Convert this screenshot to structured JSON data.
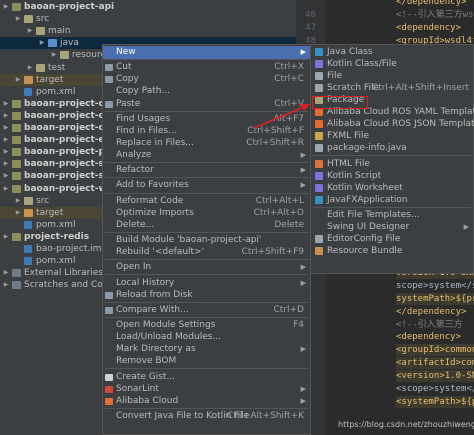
{
  "colors": {
    "menu_active": "#4b6eaf",
    "tree_bg": "#3c3f41",
    "editor_bg": "#2b2b2b",
    "red_annotation": "#e02020"
  },
  "tree": {
    "rows": [
      {
        "label": "baoan-project-api",
        "indent": 0,
        "icon": "folder-mod",
        "bold": true
      },
      {
        "label": "src",
        "indent": 1,
        "icon": "folder"
      },
      {
        "label": "main",
        "indent": 2,
        "icon": "folder"
      },
      {
        "label": "java",
        "indent": 3,
        "icon": "folder-blue",
        "selected": true
      },
      {
        "label": "resources",
        "indent": 4,
        "icon": "folder"
      },
      {
        "label": "test",
        "indent": 2,
        "icon": "folder"
      },
      {
        "label": "target",
        "indent": 1,
        "icon": "folder-orange",
        "highlight": true
      },
      {
        "label": "pom.xml",
        "indent": 1,
        "icon": "file-m"
      },
      {
        "label": "baoan-project-chec",
        "indent": 0,
        "icon": "folder-mod",
        "bold": true
      },
      {
        "label": "baoan-project-comr",
        "indent": 0,
        "icon": "folder-mod",
        "bold": true
      },
      {
        "label": "baoan-project-dao",
        "indent": 0,
        "icon": "folder-mod",
        "bold": true
      },
      {
        "label": "baoan-project-elast",
        "indent": 0,
        "icon": "folder-mod",
        "bold": true
      },
      {
        "label": "baoan-project-pack",
        "indent": 0,
        "icon": "folder-mod",
        "bold": true
      },
      {
        "label": "baoan-project-secu",
        "indent": 0,
        "icon": "folder-mod",
        "bold": true
      },
      {
        "label": "baoan-project-sms",
        "indent": 0,
        "icon": "folder-mod",
        "bold": true
      },
      {
        "label": "baoan-project-web",
        "indent": 0,
        "icon": "folder-mod",
        "bold": true
      },
      {
        "label": "src",
        "indent": 1,
        "icon": "folder"
      },
      {
        "label": "target",
        "indent": 1,
        "icon": "folder-orange",
        "highlight": true
      },
      {
        "label": "pom.xml",
        "indent": 1,
        "icon": "file-m"
      },
      {
        "label": "project-redis",
        "indent": 0,
        "icon": "folder-mod",
        "bold": true
      },
      {
        "label": "bao-project.iml",
        "indent": 1,
        "icon": "file-m"
      },
      {
        "label": "pom.xml",
        "indent": 1,
        "icon": "file-m"
      },
      {
        "label": "External Libraries",
        "indent": 0,
        "icon": "libs"
      },
      {
        "label": "Scratches and Consoles",
        "indent": 0,
        "icon": "libs"
      }
    ]
  },
  "editor": {
    "lines": [
      {
        "num": "",
        "text": "</dependency>",
        "kind": "tag"
      },
      {
        "num": "46",
        "text": "<!--引入第三方wsdl4j",
        "kind": "cmt"
      },
      {
        "num": "47",
        "text": "<dependency>",
        "kind": "tag"
      },
      {
        "num": "48",
        "text": "<groupId>wsdl4j",
        "kind": "tag"
      },
      {
        "num": "",
        "text": "",
        "kind": "tag"
      },
      {
        "num": "",
        "text": "",
        "kind": "tag"
      },
      {
        "num": "",
        "text": "",
        "kind": "tag"
      },
      {
        "num": "",
        "text": "",
        "kind": "tag"
      },
      {
        "num": "",
        "text": "",
        "kind": "tag"
      },
      {
        "num": "",
        "text": "",
        "kind": "tag"
      },
      {
        "num": "",
        "text": "",
        "kind": "tag"
      },
      {
        "num": "",
        "text": "",
        "kind": "tag"
      },
      {
        "num": "",
        "text": "",
        "kind": "tag"
      },
      {
        "num": "",
        "text": "",
        "kind": "tag"
      },
      {
        "num": "",
        "text": "",
        "kind": "tag"
      },
      {
        "num": "",
        "text": "",
        "kind": "tag"
      },
      {
        "num": "",
        "text": "",
        "kind": "tag"
      },
      {
        "num": "",
        "text": "",
        "kind": "tag"
      },
      {
        "num": "",
        "text": "",
        "kind": "tag"
      },
      {
        "num": "",
        "text": "",
        "kind": "tag"
      },
      {
        "num": "",
        "text": "artifactId>axis",
        "kind": "tag",
        "hl": true
      },
      {
        "num": "",
        "text": "version>1.0-SNA",
        "kind": "tag",
        "hl": true
      },
      {
        "num": "",
        "text": "scope>system</s",
        "kind": "txtv"
      },
      {
        "num": "",
        "text": "systemPath>${pro",
        "kind": "tag",
        "hl": true
      },
      {
        "num": "",
        "text": "</dependency>",
        "kind": "tag"
      },
      {
        "num": "",
        "text": "<!--引入第三方",
        "kind": "cmt"
      },
      {
        "num": "",
        "text": "<dependency>",
        "kind": "tag"
      },
      {
        "num": "",
        "text": "<groupId>commons",
        "kind": "tag",
        "hl": true
      },
      {
        "num": "",
        "text": "<artifactId>commo",
        "kind": "tag",
        "hl": true
      },
      {
        "num": "",
        "text": "<version>1.0-SNA",
        "kind": "tag",
        "hl": true
      },
      {
        "num": "",
        "text": "<scope>system</s",
        "kind": "txtv"
      },
      {
        "num": "",
        "text": "<systemPath>${pro",
        "kind": "tag",
        "hl": true
      }
    ]
  },
  "context_menu": {
    "items": [
      {
        "label": "New",
        "submenu": true,
        "active": true
      },
      {
        "sep": true
      },
      {
        "label": "Cut",
        "shortcut": "Ctrl+X",
        "icon": "cut-icon"
      },
      {
        "label": "Copy",
        "shortcut": "Ctrl+C",
        "icon": "copy-icon"
      },
      {
        "label": "Copy Path...",
        "shortcut": ""
      },
      {
        "label": "Paste",
        "shortcut": "Ctrl+V",
        "icon": "paste-icon"
      },
      {
        "sep": true
      },
      {
        "label": "Find Usages",
        "shortcut": "Alt+F7"
      },
      {
        "label": "Find in Files...",
        "shortcut": "Ctrl+Shift+F"
      },
      {
        "label": "Replace in Files...",
        "shortcut": "Ctrl+Shift+R"
      },
      {
        "label": "Analyze",
        "submenu": true
      },
      {
        "sep": true
      },
      {
        "label": "Refactor",
        "submenu": true
      },
      {
        "sep": true
      },
      {
        "label": "Add to Favorites",
        "submenu": true
      },
      {
        "sep": true
      },
      {
        "label": "Reformat Code",
        "shortcut": "Ctrl+Alt+L"
      },
      {
        "label": "Optimize Imports",
        "shortcut": "Ctrl+Alt+O"
      },
      {
        "label": "Delete...",
        "shortcut": "Delete"
      },
      {
        "sep": true
      },
      {
        "label": "Build Module 'baoan-project-api'",
        "shortcut": ""
      },
      {
        "label": "Rebuild '<default>'",
        "shortcut": "Ctrl+Shift+F9"
      },
      {
        "sep": true
      },
      {
        "label": "Open In",
        "submenu": true
      },
      {
        "sep": true
      },
      {
        "label": "Local History",
        "submenu": true
      },
      {
        "label": "Reload from Disk",
        "icon": "reload-icon"
      },
      {
        "sep": true
      },
      {
        "label": "Compare With...",
        "shortcut": "Ctrl+D",
        "icon": "compare-icon"
      },
      {
        "sep": true
      },
      {
        "label": "Open Module Settings",
        "shortcut": "F4"
      },
      {
        "label": "Load/Unload Modules..."
      },
      {
        "label": "Mark Directory as",
        "submenu": true
      },
      {
        "label": "Remove BOM"
      },
      {
        "sep": true
      },
      {
        "label": "Create Gist...",
        "icon": "github-icon"
      },
      {
        "label": "SonarLint",
        "submenu": true,
        "icon": "sonarlint-icon"
      },
      {
        "label": "Alibaba Cloud",
        "submenu": true,
        "icon": "alibaba-icon"
      },
      {
        "sep": true
      },
      {
        "label": "Convert Java File to Kotlin File",
        "shortcut": "Ctrl+Alt+Shift+K"
      }
    ]
  },
  "submenu": {
    "items": [
      {
        "label": "Java Class",
        "icon": "java-class-icon",
        "color": "#3592c4"
      },
      {
        "label": "Kotlin Class/File",
        "icon": "kotlin-icon",
        "color": "#7f6fd8"
      },
      {
        "label": "File",
        "icon": "file-icon",
        "color": "#9aa7b0"
      },
      {
        "label": "Scratch File",
        "shortcut": "Ctrl+Alt+Shift+Insert",
        "icon": "scratch-icon",
        "color": "#9aa7b0"
      },
      {
        "label": "Package",
        "icon": "package-icon",
        "color": "#a9a37a"
      },
      {
        "label": "Alibaba Cloud ROS YAML Template",
        "icon": "alibaba-ros-icon",
        "color": "#e56a2c"
      },
      {
        "label": "Alibaba Cloud ROS JSON Template",
        "icon": "alibaba-ros-icon",
        "color": "#e56a2c"
      },
      {
        "label": "FXML File",
        "icon": "fxml-icon",
        "color": "#d0a24c"
      },
      {
        "label": "package-info.java",
        "icon": "package-info-icon",
        "color": "#9aa7b0"
      },
      {
        "sep": true
      },
      {
        "label": "HTML File",
        "icon": "html-icon",
        "color": "#e0733b"
      },
      {
        "label": "Kotlin Script",
        "icon": "kotlin-script-icon",
        "color": "#7f6fd8"
      },
      {
        "label": "Kotlin Worksheet",
        "icon": "kotlin-worksheet-icon",
        "color": "#7f6fd8"
      },
      {
        "label": "JavaFXApplication",
        "icon": "javafx-icon",
        "color": "#3592c4"
      },
      {
        "sep": true
      },
      {
        "label": "Edit File Templates..."
      },
      {
        "label": "Swing UI Designer",
        "submenu": true
      },
      {
        "label": "EditorConfig File",
        "icon": "editorconfig-icon",
        "color": "#9aa7b0"
      },
      {
        "label": "Resource Bundle",
        "icon": "resource-bundle-icon",
        "color": "#c9914b"
      }
    ]
  },
  "watermark": "https://blog.csdn.net/zhouzhiwengang"
}
